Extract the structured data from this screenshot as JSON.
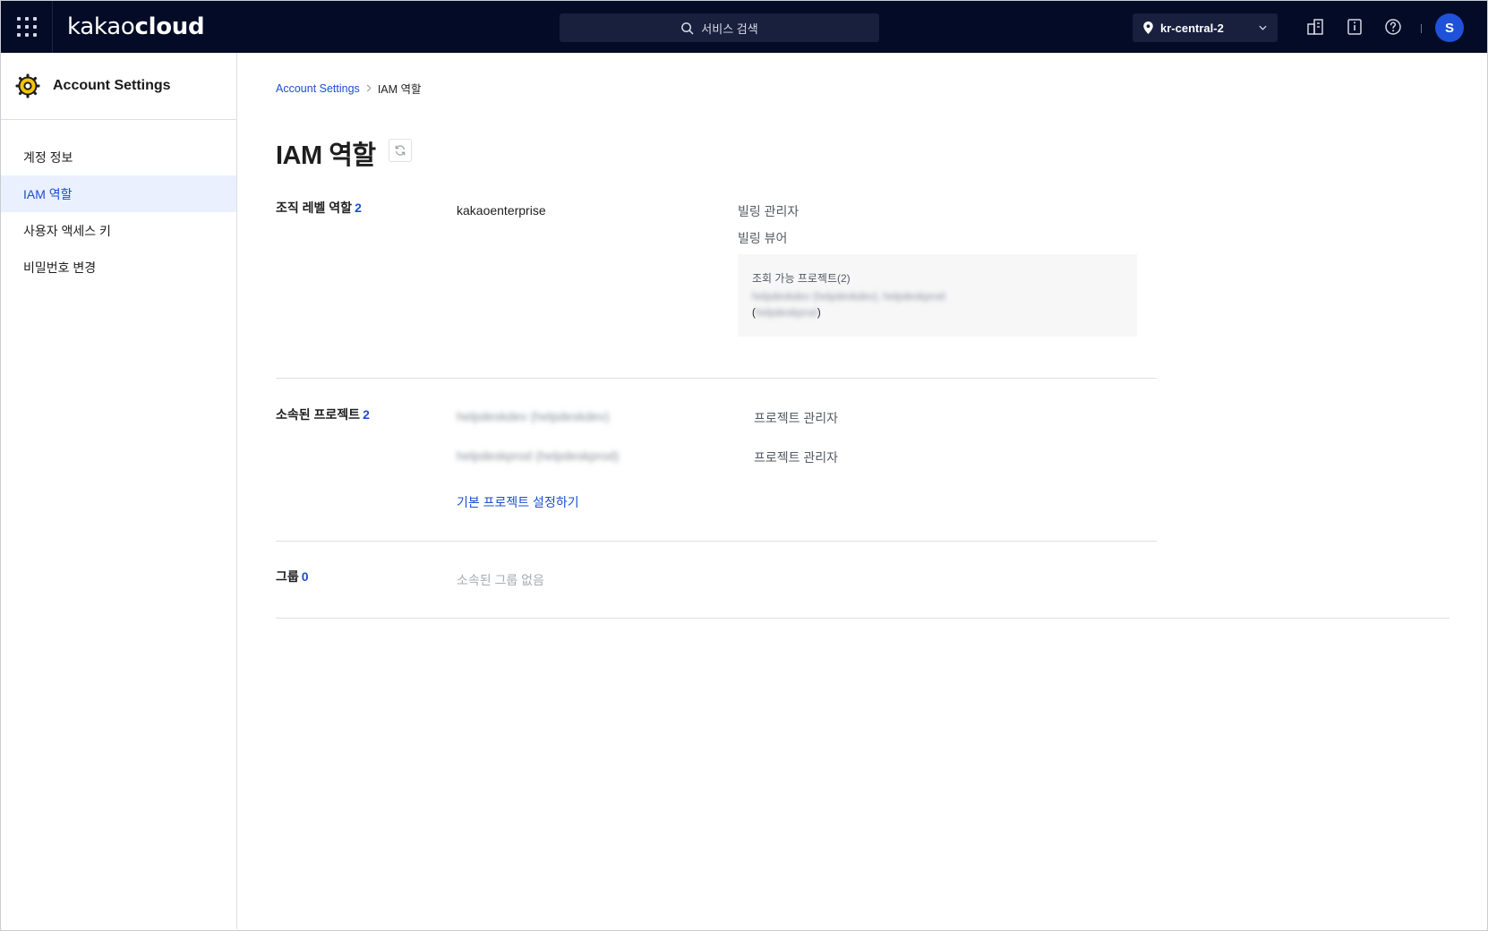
{
  "topbar": {
    "logo_light": "kakao",
    "logo_bold": "cloud",
    "search_placeholder": "서비스 검색",
    "region": "kr-central-2",
    "avatar_initial": "S"
  },
  "sidebar": {
    "title": "Account Settings",
    "items": [
      {
        "label": "계정 정보",
        "active": false
      },
      {
        "label": "IAM 역할",
        "active": true
      },
      {
        "label": "사용자 액세스 키",
        "active": false
      },
      {
        "label": "비밀번호 변경",
        "active": false
      }
    ]
  },
  "breadcrumb": {
    "parent": "Account Settings",
    "current": "IAM 역할"
  },
  "page": {
    "title": "IAM 역할"
  },
  "org_roles": {
    "label": "조직 레벨 역할",
    "count": "2",
    "org_name": "kakaoenterprise",
    "roles": [
      "빌링 관리자",
      "빌링 뷰어"
    ],
    "viewable_projects": {
      "title": "조회 가능 프로젝트(2)",
      "line1": "helpdeskdev (helpdeskdev), helpdeskprod",
      "line2_open": "(",
      "line2_masked": "helpdeskprod",
      "line2_close": ")"
    }
  },
  "projects": {
    "label": "소속된 프로젝트",
    "count": "2",
    "items": [
      {
        "name": "helpdeskdev (helpdeskdev)",
        "role": "프로젝트 관리자"
      },
      {
        "name": "helpdeskprod (helpdeskprod)",
        "role": "프로젝트 관리자"
      }
    ],
    "default_link": "기본 프로젝트 설정하기"
  },
  "groups": {
    "label": "그룹",
    "count": "0",
    "empty_text": "소속된 그룹 없음"
  }
}
